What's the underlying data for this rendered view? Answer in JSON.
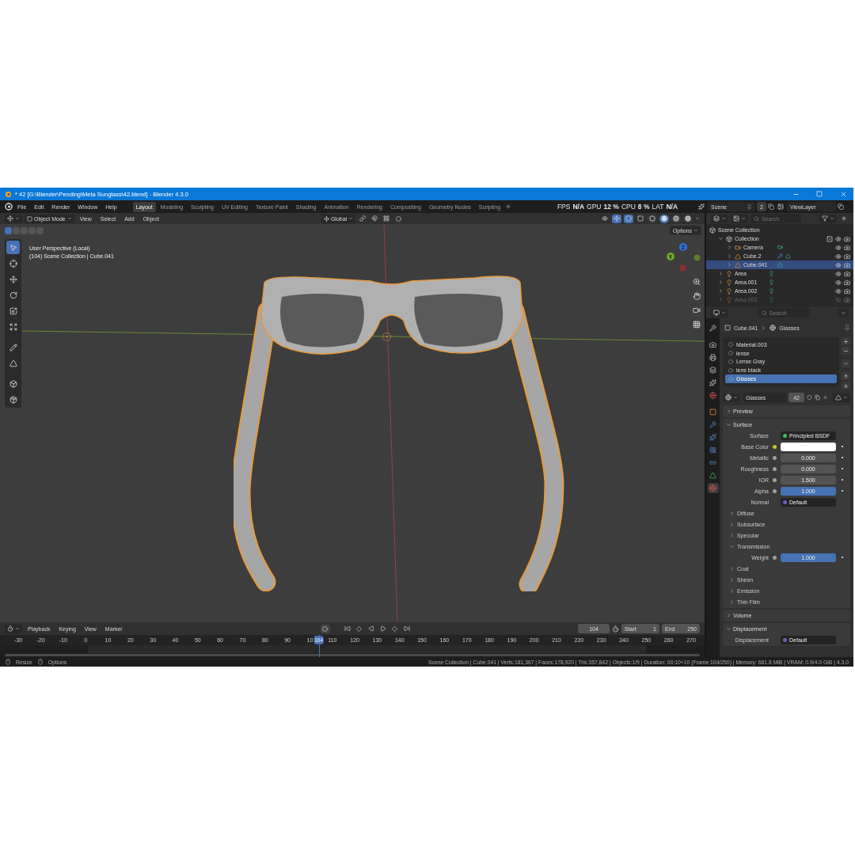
{
  "window": {
    "title": "* 42 [G:\\Blender\\Pending\\Meta Sunglass\\42.blend] - Blender 4.3.0"
  },
  "menu": [
    "File",
    "Edit",
    "Render",
    "Window",
    "Help"
  ],
  "workspaces": [
    {
      "label": "Layout",
      "selected": true
    },
    {
      "label": "Modeling",
      "selected": false
    },
    {
      "label": "Sculpting",
      "selected": false
    },
    {
      "label": "UV Editing",
      "selected": false
    },
    {
      "label": "Texture Paint",
      "selected": false
    },
    {
      "label": "Shading",
      "selected": false
    },
    {
      "label": "Animation",
      "selected": false
    },
    {
      "label": "Rendering",
      "selected": false
    },
    {
      "label": "Compositing",
      "selected": false
    },
    {
      "label": "Geometry Nodes",
      "selected": false
    },
    {
      "label": "Scripting",
      "selected": false
    }
  ],
  "stats": [
    {
      "label": "FPS",
      "value": "N/A"
    },
    {
      "label": "GPU",
      "value": "12 %"
    },
    {
      "label": "CPU",
      "value": "8 %"
    },
    {
      "label": "LAT",
      "value": "N/A"
    }
  ],
  "scene": {
    "name": "Scene",
    "users": "2"
  },
  "view_layer": "ViewLayer",
  "viewport": {
    "mode": "Object Mode",
    "menus": [
      "View",
      "Select",
      "Add",
      "Object"
    ],
    "orientation": "Global",
    "options": "Options",
    "toggles": [
      {
        "kind": "gizmos",
        "on": true
      },
      {
        "kind": "overlays",
        "on": true
      },
      {
        "kind": "xray",
        "on": false
      }
    ],
    "shading": [
      {
        "kind": "wireframe",
        "selected": false
      },
      {
        "kind": "solid",
        "selected": true
      },
      {
        "kind": "material",
        "selected": false
      },
      {
        "kind": "rendered",
        "selected": false
      }
    ],
    "overlay_lines": [
      "User Perspective (Local)",
      "(104) Scene Collection | Cube.041"
    ],
    "gizmo": [
      {
        "label": "Z",
        "color": "#2f73d9"
      },
      {
        "label": "Y",
        "color": "#6fa82c"
      }
    ],
    "tools": [
      {
        "kind": "select",
        "selected": true
      },
      {
        "kind": "cursor",
        "selected": false
      },
      {
        "kind": "move",
        "selected": false
      },
      {
        "kind": "rotate",
        "selected": false
      },
      {
        "kind": "scale",
        "selected": false
      },
      {
        "kind": "transform",
        "selected": false
      },
      {
        "kind": "annotate",
        "selected": false
      },
      {
        "kind": "measure",
        "selected": false
      },
      {
        "kind": "add_cube",
        "selected": false
      },
      {
        "kind": "cube",
        "selected": false
      }
    ]
  },
  "outliner": {
    "search_placeholder": "Search",
    "root": {
      "label": "Scene Collection",
      "kind": "scene_collection",
      "children": [
        {
          "label": "Collection",
          "kind": "collection",
          "expanded": true,
          "selected": false,
          "visible": true,
          "checked": true,
          "children": [
            {
              "label": "Camera",
              "kind": "camera",
              "expanded": false,
              "selected": false,
              "visible": true
            },
            {
              "label": "Cube.2",
              "kind": "mesh",
              "expanded": false,
              "selected": false,
              "visible": true,
              "modifier": true
            },
            {
              "label": "Cube.041",
              "kind": "mesh",
              "expanded": false,
              "selected": true,
              "visible": true
            }
          ]
        },
        {
          "label": "Area",
          "kind": "light",
          "expanded": false,
          "selected": false,
          "visible": true
        },
        {
          "label": "Area.001",
          "kind": "light",
          "expanded": false,
          "selected": false,
          "visible": true
        },
        {
          "label": "Area.002",
          "kind": "light",
          "expanded": false,
          "selected": false,
          "visible": true
        },
        {
          "label": "Area.003",
          "kind": "light",
          "expanded": false,
          "selected": false,
          "visible": false
        }
      ]
    }
  },
  "properties": {
    "search_placeholder": "Search",
    "tabs": [
      {
        "kind": "tool",
        "selected": false
      },
      {
        "kind": "render",
        "selected": false
      },
      {
        "kind": "output",
        "selected": false
      },
      {
        "kind": "view_layer",
        "selected": false
      },
      {
        "kind": "scene",
        "selected": false
      },
      {
        "kind": "world",
        "selected": false
      },
      {
        "kind": "object",
        "selected": false
      },
      {
        "kind": "modifiers",
        "selected": false
      },
      {
        "kind": "particles",
        "selected": false
      },
      {
        "kind": "physics",
        "selected": false
      },
      {
        "kind": "constraints",
        "selected": false
      },
      {
        "kind": "data",
        "selected": false
      },
      {
        "kind": "material",
        "selected": true
      }
    ],
    "breadcrumb": [
      "Cube.041",
      "Glasses"
    ],
    "material_slots": [
      {
        "label": "Material.003",
        "selected": false
      },
      {
        "label": "lense",
        "selected": false
      },
      {
        "label": "Lense Gray",
        "selected": false
      },
      {
        "label": "lens black",
        "selected": false
      },
      {
        "label": "Glasses",
        "selected": true
      }
    ],
    "material_name": "Glasses",
    "material_users": "42",
    "panels": [
      {
        "title": "Preview",
        "expanded": false
      },
      {
        "title": "Surface",
        "expanded": true,
        "items": [
          {
            "kind": "shader",
            "label": "Surface",
            "value": "Principled BSDF",
            "color": "#3fbf4f"
          },
          {
            "kind": "color",
            "label": "Base Color",
            "color": "#c7c729"
          },
          {
            "kind": "number",
            "label": "Metallic",
            "value": "0.000",
            "color": "#a1a1a1"
          },
          {
            "kind": "number",
            "label": "Roughness",
            "value": "0.000",
            "color": "#a1a1a1"
          },
          {
            "kind": "number",
            "label": "IOR",
            "value": "1.500",
            "color": "#a1a1a1"
          },
          {
            "kind": "slider",
            "label": "Alpha",
            "value": "1.000",
            "level": 1,
            "color": "#a1a1a1"
          },
          {
            "kind": "link",
            "label": "Normal",
            "value": "Default",
            "color": "#6363c7"
          },
          {
            "kind": "subpanel",
            "title": "Diffuse",
            "expanded": false
          },
          {
            "kind": "subpanel",
            "title": "Subsurface",
            "expanded": false
          },
          {
            "kind": "subpanel",
            "title": "Specular",
            "expanded": false
          },
          {
            "kind": "subpanel",
            "title": "Transmission",
            "expanded": true,
            "items": [
              {
                "kind": "slider",
                "label": "Weight",
                "value": "1.000",
                "level": 1,
                "color": "#a1a1a1"
              }
            ]
          },
          {
            "kind": "subpanel",
            "title": "Coat",
            "expanded": false
          },
          {
            "kind": "subpanel",
            "title": "Sheen",
            "expanded": false
          },
          {
            "kind": "subpanel",
            "title": "Emission",
            "expanded": false
          },
          {
            "kind": "subpanel",
            "title": "Thin Film",
            "expanded": false
          }
        ]
      },
      {
        "title": "Volume",
        "expanded": false
      },
      {
        "title": "Displacement",
        "expanded": true,
        "items": [
          {
            "kind": "link",
            "label": "Displacement",
            "value": "Default",
            "color": "#6363c7"
          }
        ]
      }
    ]
  },
  "timeline": {
    "menus": [
      "Playback",
      "Keying",
      "View",
      "Marker"
    ],
    "current_frame": "104",
    "start_label": "Start",
    "start": "1",
    "end_label": "End",
    "end": "250",
    "ruler": [
      "-30",
      "-20",
      "-10",
      "0",
      "10",
      "20",
      "30",
      "40",
      "50",
      "60",
      "70",
      "80",
      "90",
      "10",
      "110",
      "120",
      "130",
      "140",
      "150",
      "160",
      "170",
      "180",
      "190",
      "200",
      "210",
      "220",
      "230",
      "240",
      "250",
      "260",
      "270"
    ],
    "playhead": "104"
  },
  "status_bar": {
    "hints": [
      "Resize",
      "Options"
    ],
    "info": "Scene Collection | Cube.041 | Verts:181,367 | Faces:178,920 | Tris:357,842 | Objects:1/9 | Duration: 00:10+10 (Frame 104/250) | Memory: 681.8 MiB | VRAM: 0.9/4.0 GiB | 4.3.0"
  }
}
